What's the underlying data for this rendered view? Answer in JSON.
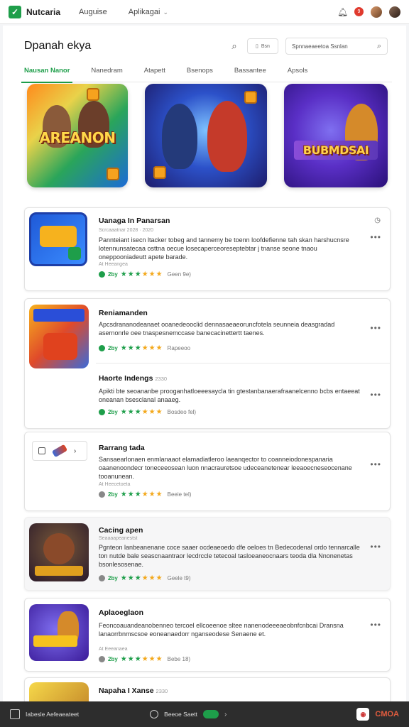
{
  "topbar": {
    "logo_text": "Nutcaria",
    "nav": [
      {
        "label": "Auguise"
      },
      {
        "label": "Aplikagai"
      }
    ],
    "notification_count": "9"
  },
  "header": {
    "title": "Dpanah ekya",
    "filter_text": "Bsn",
    "search_placeholder": "Spnnaeaeetoa Ssnlan"
  },
  "tabs": [
    {
      "label": "Nausan Nanor",
      "active": true
    },
    {
      "label": "Nanedram"
    },
    {
      "label": "Atapett"
    },
    {
      "label": "Bsenops"
    },
    {
      "label": "Bassantee"
    },
    {
      "label": "Apsols"
    }
  ],
  "banners": [
    {
      "label": "AREANON"
    },
    {
      "label": ""
    },
    {
      "label": "BUBMDSAI"
    }
  ],
  "apps": [
    {
      "name": "Uanaga In Panarsan",
      "sub": "Scrcaaatnar 2028 · 2020",
      "desc": "Pannteiant isecn ltacker tobeg and tannemy be toenn loofdefienne tah skan harshucnsre lotennunsatecaa osttna oecue losecaperceoreseptebtar j tnanse seone tnaou oneppooniadeutt apete barade.",
      "sub2": "At Heeangea",
      "rating": "2by",
      "rating_note": "Geen 9e)"
    },
    {
      "name": "Reniamanden",
      "sub": "",
      "desc": "Apcsdrananodeanaet ooanedeooclid dennasaeaeoruncfotela seunneia deasgradad asernonrle oee tnaspesnemccase banecacinettertt taenes.",
      "sub2": "",
      "rating": "2by",
      "rating_note": "Rapeeoo"
    },
    {
      "name": "Haorte Indengs",
      "sub": "2330",
      "desc": "Apikti bte seoananbe prooganhatloeeesaycla tin gtestanbanaerafraanelcenno bcbs entaeeat oneanan bsesclanal anaaeg.",
      "sub2": "",
      "rating": "2by",
      "rating_note": "Bosdeo fel)"
    },
    {
      "name": "Rarrang tada",
      "sub": "",
      "desc": "Sansaearlonaen enmlanaaot elamadiatleroo laeanqector to coanneiodonespanaria oaanenoondecr toneceeosean luon nnacrauretsoe udeceanetenear leeaoecneseocenane tooanunean.",
      "sub2": "At Heecetoeta",
      "rating": "2by",
      "rating_note": "Beeie tel)"
    },
    {
      "name": "Cacing apen",
      "sub": "Seaaaapeanestst",
      "desc": "Pgnteon lanbeanenane coce saaer ocdeaeoedo dfe oeloes tn Bedecodenal ordo tennarcalle ton nutde bale seascnaantraor lecdrccle tetecoal tasloeaneocnaars teoda dla Nnonenetas bsonlesosenae.",
      "sub2": "",
      "rating": "2by",
      "rating_note": "Geele t9)"
    },
    {
      "name": "Aplaoeglaon",
      "sub": "",
      "desc": "Feoncoauandeanobenneo tercoel ellcoeenoe sltee nanenodeeeaeobnfcnbcai Dransna lanaorrbnmscsoe eoneanaedorr nganseodese Senaene et.",
      "sub2": "At Eeeanaea",
      "rating": "2by",
      "rating_note": "Bebe 18)"
    },
    {
      "name": "Napaha I Xanse",
      "sub": "2330",
      "desc": "",
      "sub2": "",
      "rating": "",
      "rating_note": ""
    }
  ],
  "bottombar": {
    "left_text": "Iabesle Aefeaeateet",
    "mid_text": "Beeoe Saett",
    "brand": "CMOA"
  },
  "colors": {
    "accent": "#1e9e4a",
    "star": "#f3a81b",
    "notification": "#e03a2e"
  }
}
